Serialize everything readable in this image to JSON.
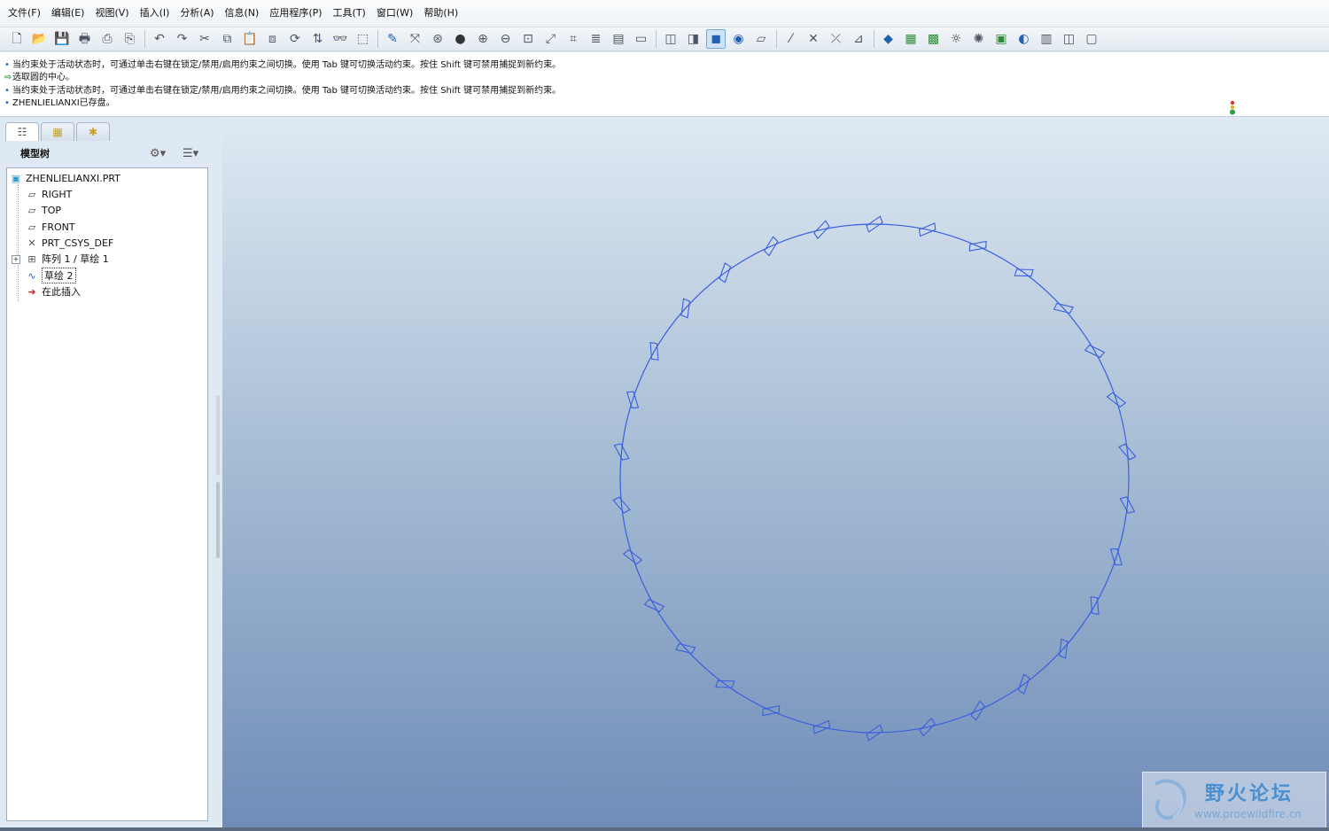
{
  "menu": [
    "文件(F)",
    "编辑(E)",
    "视图(V)",
    "插入(I)",
    "分析(A)",
    "信息(N)",
    "应用程序(P)",
    "工具(T)",
    "窗口(W)",
    "帮助(H)"
  ],
  "toolbar": {
    "icons": [
      "new-icon",
      "open-icon",
      "save-icon",
      "print-icon",
      "page-setup-icon",
      "print-preview-icon",
      "undo-icon",
      "redo-icon",
      "cut-icon",
      "copy-icon",
      "paste-icon",
      "paste-special-icon",
      "regenerate-icon",
      "regen-manager-icon",
      "find-icon",
      "select-box-icon",
      "sketch-icon",
      "datum-axis-icon",
      "datum-point-icon",
      "shading-icon",
      "zoom-in-icon",
      "zoom-out-icon",
      "refit-icon",
      "reorient-icon",
      "saved-views-icon",
      "layers-icon",
      "view-manager-icon",
      "wireframe-icon",
      "hidden-line-icon",
      "no-hidden-icon",
      "shading-mode-icon",
      "appearance-icon",
      "datum-plane-display-icon",
      "datum-axis-display-icon",
      "point-display-icon",
      "csys-display-icon",
      "annotation-display-icon",
      "model-tree-icon",
      "datum-features-icon",
      "grid-icon",
      "light-icon",
      "spin-center-icon",
      "render-icon",
      "mapkey-icon",
      "model-player-icon",
      "measure-icon",
      "blank-icon"
    ]
  },
  "messages": [
    {
      "type": "bullet",
      "text": "当约束处于活动状态时，可通过单击右键在锁定/禁用/启用约束之间切换。使用 Tab 键可切换活动约束。按住 Shift 键可禁用捕捉到新约束。"
    },
    {
      "type": "prompt",
      "text": "选取圆的中心。"
    },
    {
      "type": "bullet",
      "text": "当约束处于活动状态时，可通过单击右键在锁定/禁用/启用约束之间切换。使用 Tab 键可切换活动约束。按住 Shift 键可禁用捕捉到新约束。"
    },
    {
      "type": "bullet",
      "text": "ZHENLIELIANXI已存盘。"
    }
  ],
  "model_tree": {
    "title": "模型树",
    "items": [
      {
        "label": "ZHENLIELIANXI.PRT",
        "icon": "part-icon"
      },
      {
        "label": "RIGHT",
        "icon": "datum-plane-icon"
      },
      {
        "label": "TOP",
        "icon": "datum-plane-icon"
      },
      {
        "label": "FRONT",
        "icon": "datum-plane-icon"
      },
      {
        "label": "PRT_CSYS_DEF",
        "icon": "csys-icon"
      },
      {
        "label": "阵列 1 / 草绘 1",
        "icon": "pattern-icon"
      },
      {
        "label": "草绘 2",
        "icon": "sketch-icon"
      },
      {
        "label": "在此插入",
        "icon": "insert-here-icon"
      }
    ]
  },
  "viewport": {
    "diamond_count": 30,
    "stroke_color": "#3a5fe0"
  },
  "watermark": {
    "title": "野火论坛",
    "url": "www.proewildfire.cn"
  }
}
